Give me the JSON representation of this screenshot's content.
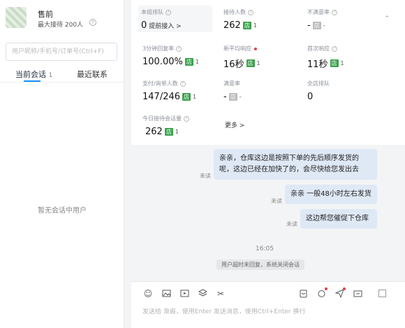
{
  "profile": {
    "name": "售前",
    "max_reception": "最大接待 200人"
  },
  "search": {
    "placeholder": "用户昵称/手机号/订单号(Ctrl+F)"
  },
  "tabs": {
    "current": "当前会话",
    "current_count": "1",
    "recent": "最近联系"
  },
  "empty_text": "暂无会话中用户",
  "stats": [
    {
      "label": "本组排队",
      "value": "0",
      "link": "提前接入 >"
    },
    {
      "label": "接待人数",
      "value": "262",
      "badge": "店",
      "badge_n": "1"
    },
    {
      "label": "不满意率",
      "value": "-",
      "badge": "店",
      "badge_n": "-"
    },
    {
      "label": "3分钟回复率",
      "value": "100.00%",
      "badge": "店",
      "badge_n": "1"
    },
    {
      "label": "新平均响应",
      "value": "16秒",
      "badge": "店",
      "badge_n": "1"
    },
    {
      "label": "首次响应",
      "value": "11秒",
      "badge": "店",
      "badge_n": "1"
    },
    {
      "label": "支付/询单人数",
      "value": "147/246",
      "badge": "店",
      "badge_n": "1"
    },
    {
      "label": "满意率",
      "value": "-",
      "badge": "店",
      "badge_n": "-"
    },
    {
      "label": "全店排队",
      "value": "0"
    },
    {
      "label": "今日接待会话量",
      "value": "262",
      "badge": "店",
      "badge_n": "1"
    }
  ],
  "more_label": "更多 >",
  "chat": {
    "messages": [
      {
        "lines": [
          "亲亲，仓库这边是按照下单的先后顺序发货的",
          "呢，这边已经在加快了的，会尽快给您发出去"
        ],
        "status": "未读"
      },
      {
        "lines": [
          "亲亲 一般48小时左右发货"
        ],
        "status": "未读"
      },
      {
        "lines": [
          "这边帮您催促下仓库"
        ],
        "status": "未读"
      }
    ],
    "time": "16:05",
    "system_notice": "用户超时未回复，系统关闭会话"
  },
  "composer": {
    "placeholder": "发送给 渐霞，使用Enter 发送消息，使用Ctrl+Enter 换行"
  },
  "colors": {
    "accent": "#1890ff",
    "badge_green": "#3aa24c",
    "bubble": "#dfe8f5"
  }
}
